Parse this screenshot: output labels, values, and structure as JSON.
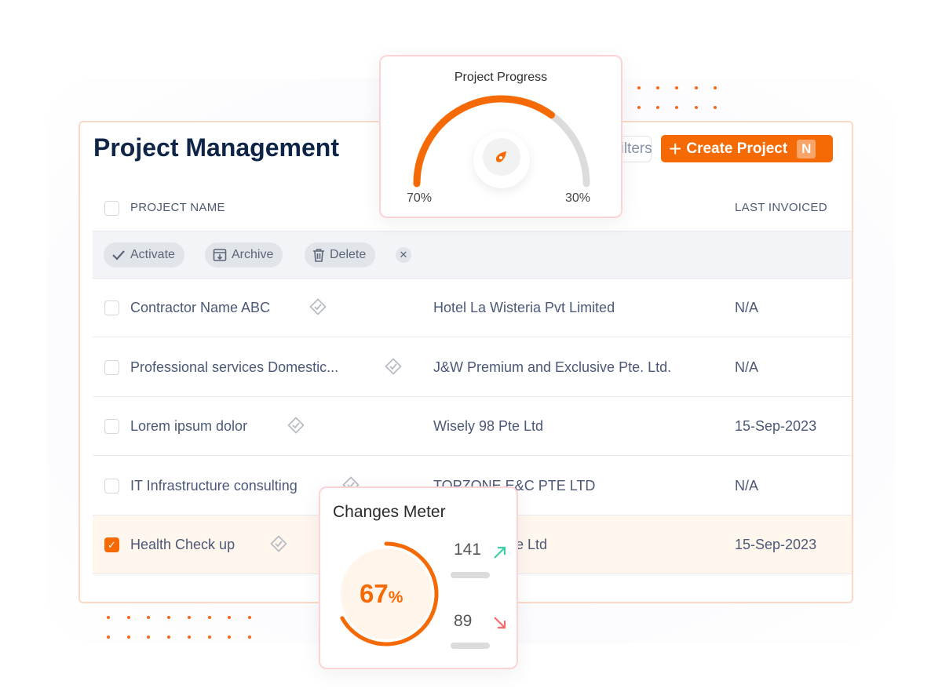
{
  "header": {
    "title": "Project Management",
    "filters_label": "Filters",
    "create_label": "Create Project",
    "create_shortcut": "N"
  },
  "table": {
    "columns": [
      "PROJECT NAME",
      "LAST INVOICED"
    ],
    "bulk_actions": {
      "activate": "Activate",
      "archive": "Archive",
      "delete": "Delete"
    },
    "rows": [
      {
        "name": "Contractor Name ABC",
        "client": "Hotel La Wisteria Pvt Limited",
        "last_invoiced": "N/A",
        "checked": false
      },
      {
        "name": "Professional services Domestic...",
        "client": "J&W Premium and Exclusive Pte. Ltd.",
        "last_invoiced": "N/A",
        "checked": false
      },
      {
        "name": "Lorem ipsum dolor",
        "client": "Wisely 98 Pte Ltd",
        "last_invoiced": "15-Sep-2023",
        "checked": false
      },
      {
        "name": "IT Infrastructure consulting",
        "client": "TOPZONE E&C PTE LTD",
        "last_invoiced": "N/A",
        "checked": false
      },
      {
        "name": "Health Check up",
        "client": "Driving Centre Ltd",
        "last_invoiced": "15-Sep-2023",
        "checked": true
      }
    ]
  },
  "project_progress": {
    "title": "Project Progress",
    "done_label": "70%",
    "remaining_label": "30%",
    "done": 70,
    "remaining": 30
  },
  "changes_meter": {
    "title": "Changes Meter",
    "percent": 67,
    "percent_value": "67",
    "percent_sign": "%",
    "up_value": "141",
    "down_value": "89"
  },
  "colors": {
    "accent": "#f56a05",
    "title": "#0f2547",
    "up": "#3fcfa8",
    "down": "#f56b6b",
    "selected_row": "#fff6ee"
  }
}
